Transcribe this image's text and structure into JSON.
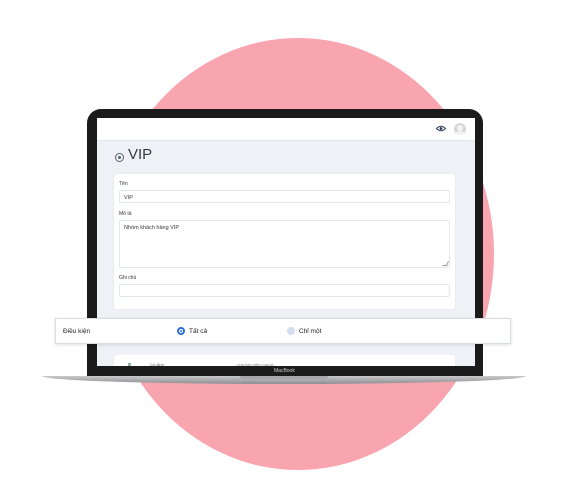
{
  "header": {
    "view_icon": "eye-icon",
    "avatar_icon": "user-avatar-icon"
  },
  "page": {
    "title": "VIP",
    "back_icon": "back-circle-icon"
  },
  "form": {
    "name_label": "Tên",
    "name_value": "VIP",
    "desc_label": "Mô tả",
    "desc_value": "Nhóm khách hàng VIP",
    "note_label": "Ghi chú",
    "note_value": ""
  },
  "conditions": {
    "label": "Điều kiện",
    "options": [
      {
        "label": "Tất cả",
        "selected": true
      },
      {
        "label": "Chỉ một",
        "selected": false
      }
    ]
  },
  "lower_card": {
    "col1": "Cố định",
    "col2": "...ông bảo hiểm người..."
  },
  "device": {
    "brand": "MacBook"
  },
  "colors": {
    "accent": "#2f6fd6",
    "backdrop": "#f8a5b0"
  }
}
